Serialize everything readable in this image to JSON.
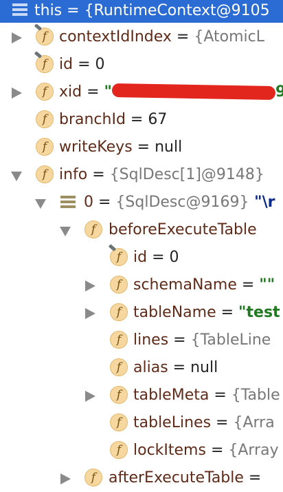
{
  "header": {
    "text": "this = {RuntimeContext@9105"
  },
  "rows": [
    {
      "name": "contextIdIndex",
      "eq": " = ",
      "value": "{AtomicL"
    },
    {
      "name": "id",
      "eq": " = ",
      "value": "0"
    },
    {
      "name": "xid",
      "eq": " = ",
      "quote_open": "\"",
      "value_tail": "9"
    },
    {
      "name": "branchId",
      "eq": " = ",
      "value": "67"
    },
    {
      "name": "writeKeys",
      "eq": " = ",
      "value": "null"
    },
    {
      "name": "info",
      "eq": " = ",
      "value": "{SqlDesc[1]@9148}"
    },
    {
      "name": "0",
      "eq": " = ",
      "value": "{SqlDesc@9169}",
      "extra": " \"\\r"
    },
    {
      "name": "beforeExecuteTable",
      "eq": " ",
      "value": ""
    },
    {
      "name": "id",
      "eq": " = ",
      "value": "0"
    },
    {
      "name": "schemaName",
      "eq": " = ",
      "value": "\"\""
    },
    {
      "name": "tableName",
      "eq": " = ",
      "value": "\"test"
    },
    {
      "name": "lines",
      "eq": " = ",
      "value": "{TableLine"
    },
    {
      "name": "alias",
      "eq": " = ",
      "value": "null"
    },
    {
      "name": "tableMeta",
      "eq": " = ",
      "value": "{Table"
    },
    {
      "name": "tableLines",
      "eq": " = ",
      "value": "{Arra"
    },
    {
      "name": "lockItems",
      "eq": " = ",
      "value": "{Array"
    },
    {
      "name": "afterExecuteTable",
      "eq": " = ",
      "value": ""
    }
  ],
  "icons": {
    "field": "f",
    "expand": "chevron-right-icon",
    "collapse": "chevron-down-icon"
  }
}
